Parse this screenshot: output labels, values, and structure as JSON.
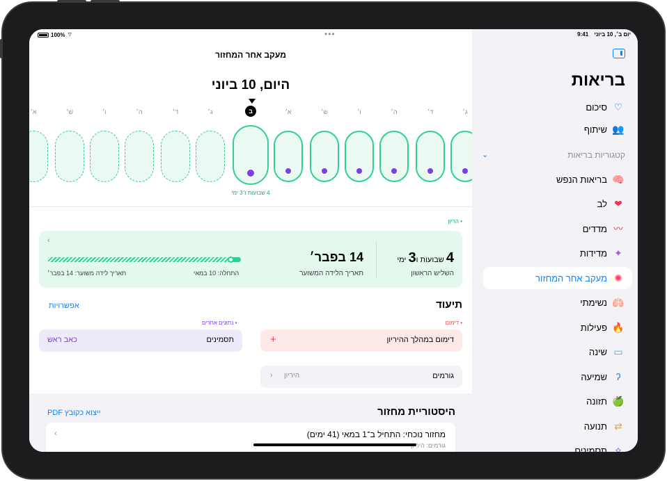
{
  "status": {
    "battery": "100%",
    "time": "9:41",
    "date": "יום ב׳, 10 ביוני"
  },
  "sidebar": {
    "title": "בריאות",
    "items_top": [
      {
        "label": "סיכום",
        "icon": "heart-outline-icon"
      },
      {
        "label": "שיתוף",
        "icon": "people-icon"
      }
    ],
    "categories_label": "קטגוריות בריאות",
    "categories": [
      {
        "label": "בריאות הנפש",
        "icon": "brain-icon"
      },
      {
        "label": "לב",
        "icon": "heart-icon"
      },
      {
        "label": "מדדים",
        "icon": "vitals-icon"
      },
      {
        "label": "מדידות",
        "icon": "body-measure-icon"
      },
      {
        "label": "מעקב אחר המחזור",
        "icon": "cycle-tracking-icon",
        "selected": true
      },
      {
        "label": "נשימתי",
        "icon": "lungs-icon"
      },
      {
        "label": "פעילות",
        "icon": "flame-icon"
      },
      {
        "label": "שינה",
        "icon": "bed-icon"
      },
      {
        "label": "שמיעה",
        "icon": "ear-icon"
      },
      {
        "label": "תזונה",
        "icon": "apple-icon"
      },
      {
        "label": "תנועה",
        "icon": "arrows-icon"
      },
      {
        "label": "תסמינים",
        "icon": "figure-icon"
      }
    ]
  },
  "main": {
    "nav_title": "מעקב אחר המחזור",
    "date_title": "היום, 10 ביוני",
    "day_letters": [
      "א׳",
      "ש׳",
      "ו׳",
      "ה׳",
      "ד׳",
      "ג׳",
      "ב",
      "א׳",
      "ש׳",
      "ו׳",
      "ה׳",
      "ד׳",
      "ג׳"
    ],
    "today_letter": "ב",
    "weeks_label": "4 שבועות ו־3 ימי",
    "pregnancy_tag": "הריון",
    "pregnancy": {
      "weeks_number": "4",
      "weeks_word": "שבועות ו",
      "days_number": "3",
      "days_word": "ימי",
      "trimester": "השליש הראשון",
      "due_date": "14 בפבר׳",
      "due_label": "תאריך הלידה המשוער",
      "start_label": "התחלה: 10 במאי",
      "estimated_label": "תאריך לידה משוער: 14 בפבר׳",
      "progress_fraction": 0.95
    },
    "log": {
      "title": "תיעוד",
      "options": "אפשרויות",
      "bleeding_tag": "דימום",
      "other_tag": "נתונים אחרים",
      "bleeding_label": "דימום במהלך ההיריון",
      "symptoms_label": "תסמינים",
      "symptoms_value": "כאב ראש",
      "factors_label": "גורמים",
      "factors_value": "היריון"
    },
    "history": {
      "title": "היסטוריית מחזור",
      "export": "ייצוא כקובץ PDF",
      "current_cycle": "מחזור נוכחי: התחיל ב־1 במאי (41 ימים)",
      "factors_line": "גורמים: היריון"
    }
  },
  "colors": {
    "accent": "#0a84ff",
    "green": "#30d190",
    "purple": "#7b3fe4",
    "red": "#e5484d"
  }
}
